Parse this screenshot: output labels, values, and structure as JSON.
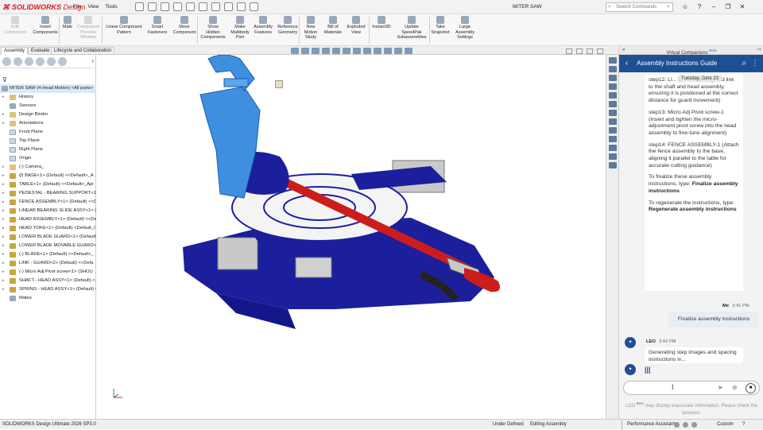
{
  "app": {
    "logo_brand": "SOLIDWORKS",
    "logo_suffix": "Design",
    "document_title": "MITER SAW"
  },
  "menu": [
    "File",
    "View",
    "Tools"
  ],
  "search": {
    "placeholder": "Search Commands"
  },
  "ribbon": [
    {
      "label": "Edit\nComponent",
      "enabled": false
    },
    {
      "label": "Insert\nComponents",
      "enabled": true
    },
    {
      "label": "Mate",
      "enabled": true
    },
    {
      "label": "Component\nPreview\nWindow",
      "enabled": false
    },
    {
      "label": "Linear Component\nPattern",
      "enabled": true
    },
    {
      "label": "Smart\nFasteners",
      "enabled": true
    },
    {
      "label": "Move\nComponent",
      "enabled": true
    },
    {
      "label": "Show\nHidden\nComponents",
      "enabled": true
    },
    {
      "label": "Make\nMultibody\nPart",
      "enabled": true
    },
    {
      "label": "Assembly\nFeatures",
      "enabled": true
    },
    {
      "label": "Reference\nGeometry",
      "enabled": true
    },
    {
      "label": "New\nMotion\nStudy",
      "enabled": true
    },
    {
      "label": "Bill of\nMaterials",
      "enabled": true
    },
    {
      "label": "Exploded\nView",
      "enabled": true
    },
    {
      "label": "Instant3D",
      "enabled": true
    },
    {
      "label": "Update\nSpeedPak\nSubassemblies",
      "enabled": true
    },
    {
      "label": "Take\nSnapshot",
      "enabled": true
    },
    {
      "label": "Large\nAssembly\nSettings",
      "enabled": true
    }
  ],
  "tabs": [
    "Assembly",
    "Evaluate",
    "Lifecycle and Collaboration"
  ],
  "tree": {
    "root": "MITER SAW (4-Head Motion) <All parts>",
    "items": [
      {
        "label": "History",
        "icon": "folder-icon",
        "expand": true
      },
      {
        "label": "Sensors",
        "icon": "sensor-icon",
        "expand": false
      },
      {
        "label": "Design Binder",
        "icon": "binder-icon",
        "expand": true
      },
      {
        "label": "Annotations",
        "icon": "annotation-icon",
        "expand": true
      },
      {
        "label": "Front Plane",
        "icon": "plane-icon",
        "expand": false
      },
      {
        "label": "Top Plane",
        "icon": "plane-icon",
        "expand": false
      },
      {
        "label": "Right Plane",
        "icon": "plane-icon",
        "expand": false
      },
      {
        "label": "Origin",
        "icon": "origin-icon",
        "expand": false
      },
      {
        "label": "(-) Camera_",
        "icon": "camera-icon",
        "expand": true
      },
      {
        "label": "(f) BASE<1> (Default) <<Default>_A",
        "icon": "part-icon",
        "expand": true
      },
      {
        "label": "TABLE<1> (Default) <<Default>_Apl",
        "icon": "part-icon",
        "expand": true
      },
      {
        "label": "PEDESTAL - BEARING SUPPORT<1>",
        "icon": "part-icon",
        "expand": true
      },
      {
        "label": "FENCE ASSEMBLY<1> (Default) <<D",
        "icon": "subassembly-icon",
        "expand": true
      },
      {
        "label": "LINEAR BEARING SLIDE ASSY<1> (De",
        "icon": "subassembly-icon",
        "expand": true
      },
      {
        "label": "HEAD ASSEMBLY<1> (Default) <<De",
        "icon": "subassembly-icon",
        "expand": true
      },
      {
        "label": "HEAD YOKE<1> (Default) <Default_I",
        "icon": "part-icon",
        "expand": true
      },
      {
        "label": "LOWER BLADE GUARD<1> (Default)",
        "icon": "part-icon",
        "expand": true
      },
      {
        "label": "LOWER BLADE MOVABLE GUARD<1",
        "icon": "part-icon",
        "expand": true
      },
      {
        "label": "(-) BLADE<1> (Default) <<Default>_",
        "icon": "part-icon",
        "expand": true
      },
      {
        "label": "LINK - GUARD<2> (Default) <<Defa",
        "icon": "part-icon",
        "expand": true
      },
      {
        "label": "(-) Micro Adj Pivot screw<1> (SHOU",
        "icon": "part-icon",
        "expand": true
      },
      {
        "label": "SHAFT - HEAD ASSY<1> (Default) <",
        "icon": "part-icon",
        "expand": true
      },
      {
        "label": "SPRING - HEAD ASSY<1> (Default) <",
        "icon": "part-icon",
        "expand": true
      },
      {
        "label": "Mates",
        "icon": "mates-icon",
        "expand": false
      }
    ]
  },
  "companion": {
    "header": "Virtual Companions",
    "header_beta": "Beta",
    "guide_title": "Assembly Instructions Guide",
    "date_chip": "Tuesday, June 23",
    "messages_ai": [
      {
        "text": "step12: LI... (Connect the guard link to the shaft and head assembly, ensuring it is positioned at the correct distance for guard movement)"
      },
      {
        "text": "step13: Micro Adj Pivot screw-1 (Insert and tighten the micro-adjustment pivot screw into the head assembly to fine-tune alignment)"
      },
      {
        "text": "step14: FENCE ASSEMBLY-1 (Attach the fence assembly to the base, aligning it parallel to the table for accurate cutting guidance)"
      }
    ],
    "finalize_prefix": "To finalize these assembly instructions, type: ",
    "finalize_cmd": "Finalize assembly instructions",
    "regen_prefix": "To regenerate the instructions, type: ",
    "regen_cmd": "Regenerate assembly instructions",
    "me_name": "Me",
    "me_time": "3:41 PM",
    "me_text": "Finalize assembly instructions",
    "leo_name": "LEO",
    "leo_time": "3:42 PM",
    "leo_text": "Generating step images and spacing instructions in...",
    "disclaimer_name": "LEO",
    "disclaimer_beta": "Beta",
    "disclaimer_text": "may display inaccurate information. Please check the answers."
  },
  "status": {
    "version": "SOLIDWORKS Design Ultimate 2026 SP3.0",
    "state1": "Under Defined",
    "state2": "Editing Assembly",
    "perf": "Performance Assistant:",
    "custom": "Custom"
  },
  "colors": {
    "brand_red": "#d71920",
    "guide_blue": "#1e4f92",
    "model_navy": "#1c1f9c",
    "model_lightblue": "#3f8fe0",
    "model_red": "#cc1d1d"
  }
}
